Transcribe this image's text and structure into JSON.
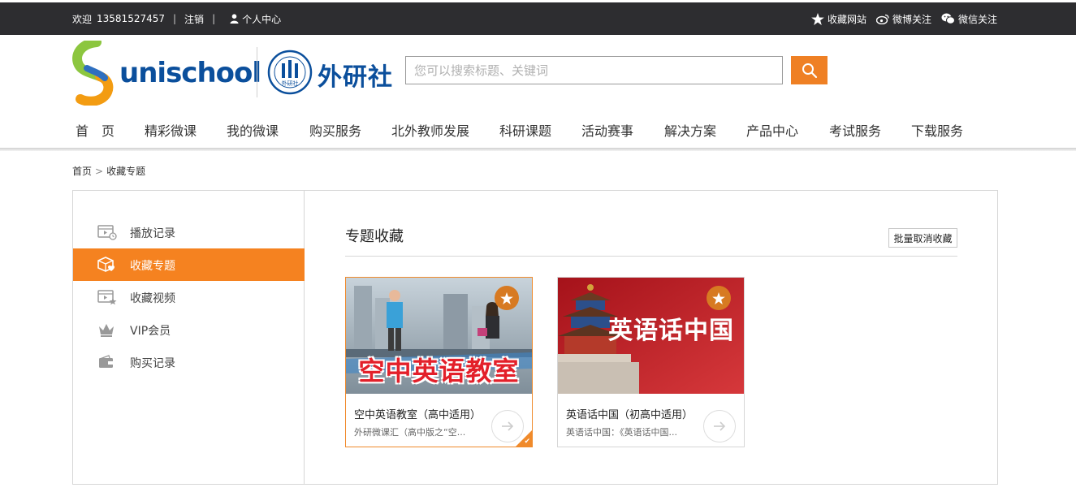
{
  "topbar": {
    "welcome": "欢迎",
    "phone": "13581527457",
    "sep": "|",
    "logout": "注销",
    "user_center": "个人中心",
    "favorite_site": "收藏网站",
    "weibo": "微博关注",
    "wechat": "微信关注"
  },
  "brand": {
    "uni_name": "unischool",
    "fltrp_name": "外研社",
    "seal_text": "外研社"
  },
  "search": {
    "placeholder": "您可以搜索标题、关键词"
  },
  "nav": {
    "items": [
      "首　页",
      "精彩微课",
      "我的微课",
      "购买服务",
      "北外教师发展",
      "科研课题",
      "活动赛事",
      "解决方案",
      "产品中心",
      "考试服务",
      "下载服务"
    ]
  },
  "breadcrumb": {
    "home": "首页",
    "gt": ">",
    "current": "收藏专题"
  },
  "sidebar": {
    "items": [
      {
        "label": "播放记录",
        "icon": "play-history-icon"
      },
      {
        "label": "收藏专题",
        "icon": "favorite-topic-icon",
        "active": true
      },
      {
        "label": "收藏视频",
        "icon": "favorite-video-icon"
      },
      {
        "label": "VIP会员",
        "icon": "crown-icon"
      },
      {
        "label": "购买记录",
        "icon": "wallet-icon"
      }
    ]
  },
  "main": {
    "title": "专题收藏",
    "batch_cancel": "批量取消收藏",
    "cards": [
      {
        "thumb_text": "空中英语教室",
        "title": "空中英语教室（高中适用）",
        "desc": "外研微课汇（高中版之“空...",
        "selected": true
      },
      {
        "thumb_text": "英语话中国",
        "title": "英语话中国（初高中适用）",
        "desc": "英语话中国：《英语话中国...",
        "selected": false
      }
    ]
  },
  "colors": {
    "accent": "#f58220",
    "topbar_bg": "#2d2d30",
    "brand_blue": "#0b4f9c"
  }
}
